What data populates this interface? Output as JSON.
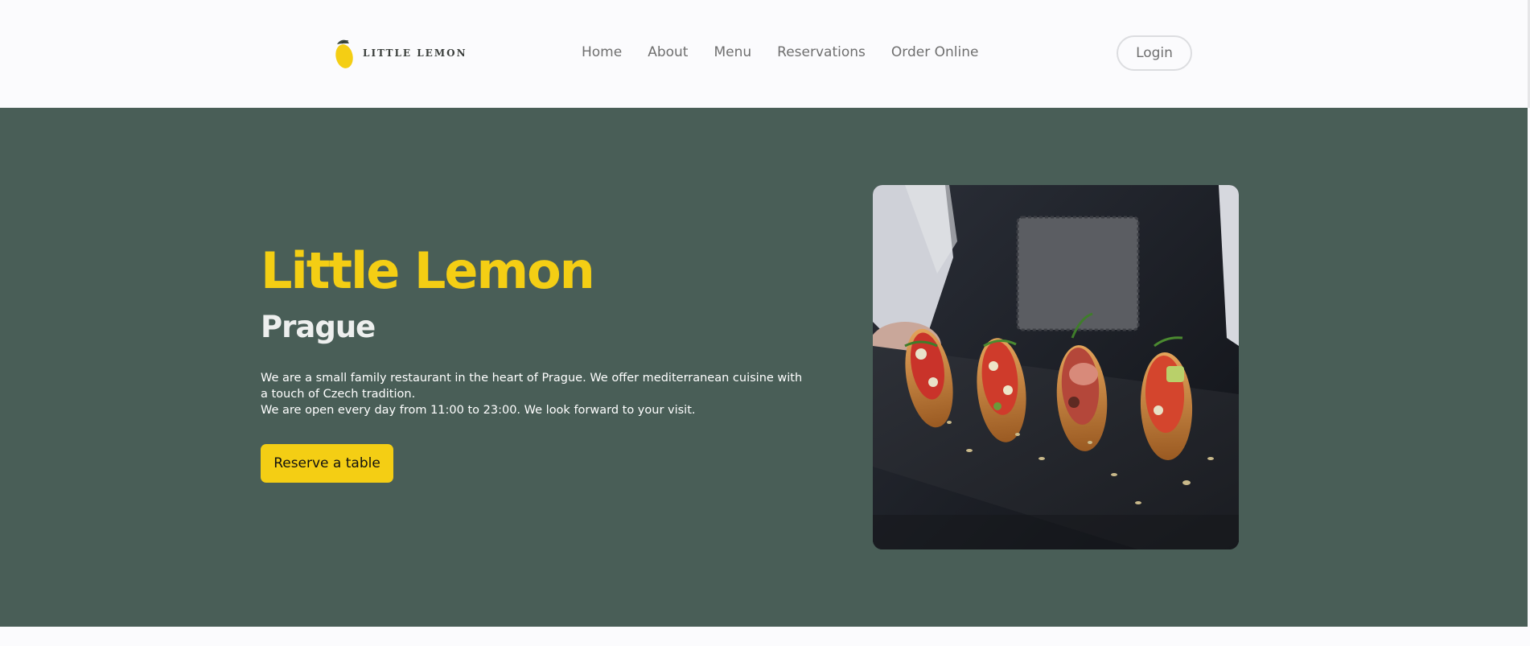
{
  "brand": {
    "name": "LITTLE LEMON",
    "logo_icon": "lemon-icon",
    "colors": {
      "primary_green": "#495e57",
      "primary_yellow": "#f4ce14",
      "text_light": "#edefee"
    }
  },
  "nav": {
    "items": [
      {
        "label": "Home"
      },
      {
        "label": "About"
      },
      {
        "label": "Menu"
      },
      {
        "label": "Reservations"
      },
      {
        "label": "Order Online"
      }
    ],
    "login_label": "Login"
  },
  "hero": {
    "title": "Little Lemon",
    "subtitle": "Prague",
    "description_line1": "We are a small family restaurant in the heart of Prague. We offer mediterranean cuisine with a touch of Czech tradition.",
    "description_line2": "We are open every day from 11:00 to 23:00. We look forward to your visit.",
    "cta_label": "Reserve a table",
    "image_subject": "bruschetta-appetizers-on-slate-tray"
  }
}
